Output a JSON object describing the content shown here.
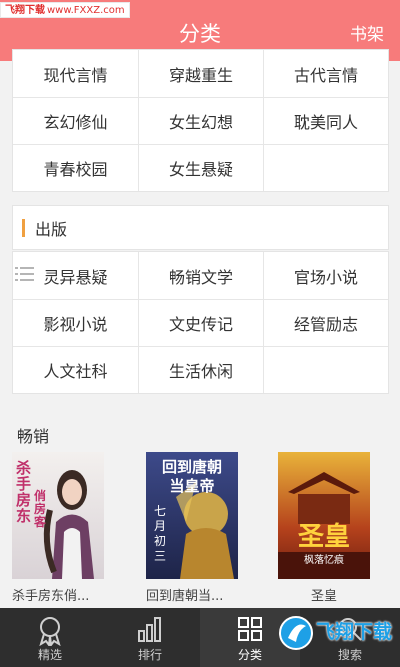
{
  "watermark": {
    "brand": "飞翔下载",
    "url": "www.FXXZ.com"
  },
  "header": {
    "title": "分类",
    "bookshelf": "书架"
  },
  "grid_top": {
    "rows": [
      [
        "现代言情",
        "穿越重生",
        "古代言情"
      ],
      [
        "玄幻修仙",
        "女生幻想",
        "耽美同人"
      ],
      [
        "青春校园",
        "女生悬疑",
        ""
      ]
    ]
  },
  "section_publish": {
    "title": "出版",
    "rows": [
      [
        "灵异悬疑",
        "畅销文学",
        "官场小说"
      ],
      [
        "影视小说",
        "文史传记",
        "经管励志"
      ],
      [
        "人文社科",
        "生活休闲",
        ""
      ]
    ]
  },
  "bestseller": {
    "title": "畅销",
    "books": [
      {
        "title": "杀手房东俏...",
        "cover_text": [
          "杀手房东",
          "俏房客"
        ]
      },
      {
        "title": "回到唐朝当...",
        "cover_text": [
          "回到唐朝",
          "当皇帝",
          "七月初三"
        ]
      },
      {
        "title": "圣皇",
        "cover_text": [
          "圣皇",
          "枫落忆痕"
        ]
      }
    ]
  },
  "tabbar": {
    "tabs": [
      {
        "label": "精选",
        "icon": "award-icon"
      },
      {
        "label": "排行",
        "icon": "bar-chart-icon"
      },
      {
        "label": "分类",
        "icon": "grid-icon"
      },
      {
        "label": "搜索",
        "icon": "search-icon"
      }
    ]
  },
  "logo": {
    "text": "飞翔下载"
  },
  "colors": {
    "header": "#f77b7b",
    "accent": "#f0a040",
    "tabbar": "#2e2e2e"
  }
}
